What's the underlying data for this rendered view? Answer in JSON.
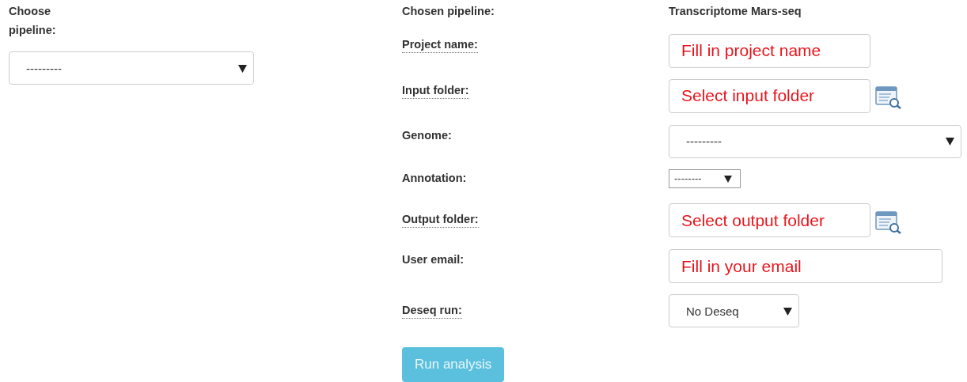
{
  "left": {
    "label": "Choose pipeline:",
    "select": {
      "value": "---------"
    }
  },
  "chosen": {
    "label": "Chosen pipeline:",
    "value": "Transcriptome Mars-seq"
  },
  "fields": [
    {
      "label": "Project name:",
      "has_tooltip": true,
      "kind": "text",
      "placeholder": "Fill in project name"
    },
    {
      "label": "Input folder:",
      "has_tooltip": true,
      "kind": "browse",
      "placeholder": "Select input folder"
    },
    {
      "label": "Genome:",
      "has_tooltip": false,
      "kind": "select",
      "value": "---------"
    },
    {
      "label": "Annotation:",
      "has_tooltip": false,
      "kind": "small-select",
      "value": "--------"
    },
    {
      "label": "Output folder:",
      "has_tooltip": true,
      "kind": "browse",
      "placeholder": "Select output folder"
    },
    {
      "label": "User email:",
      "has_tooltip": false,
      "kind": "text",
      "placeholder": "Fill in your email"
    },
    {
      "label": "Deseq run:",
      "has_tooltip": true,
      "kind": "select",
      "value": "No Deseq"
    }
  ],
  "button": {
    "label": "Run analysis",
    "disabled": true
  }
}
